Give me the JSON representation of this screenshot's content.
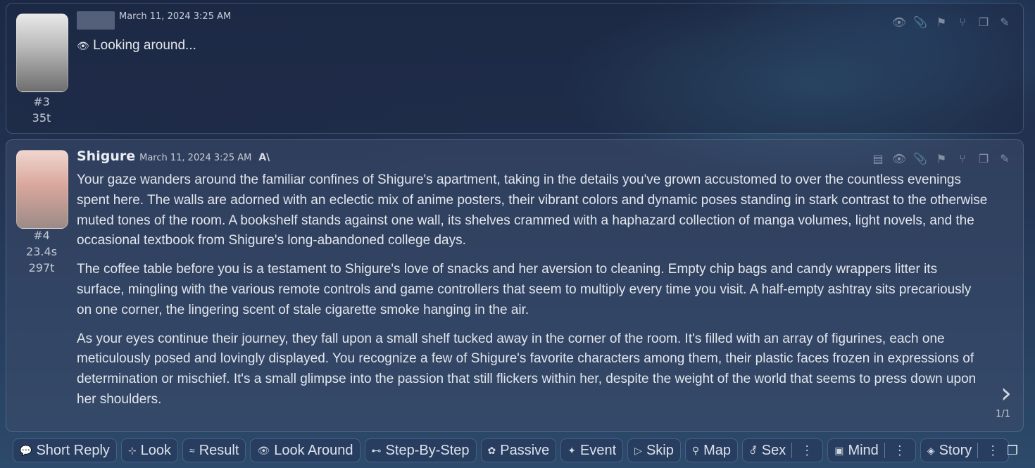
{
  "messages": [
    {
      "id": "#3",
      "tokens": "35t",
      "name": "",
      "timestamp": "March 11, 2024 3:25 AM",
      "text_icon": "eye-icon",
      "text": "Looking around..."
    },
    {
      "id": "#4",
      "gen_time": "23.4s",
      "tokens": "297t",
      "name": "Shigure",
      "timestamp": "March 11, 2024 3:25 AM",
      "model_badge": "A\\",
      "paragraphs": [
        "Your gaze wanders around the familiar confines of Shigure's apartment, taking in the details you've grown accustomed to over the countless evenings spent here. The walls are adorned with an eclectic mix of anime posters, their vibrant colors and dynamic poses standing in stark contrast to the otherwise muted tones of the room. A bookshelf stands against one wall, its shelves crammed with a haphazard collection of manga volumes, light novels, and the occasional textbook from Shigure's long-abandoned college days.",
        "The coffee table before you is a testament to Shigure's love of snacks and her aversion to cleaning. Empty chip bags and candy wrappers litter its surface, mingling with the various remote controls and game controllers that seem to multiply every time you visit. A half-empty ashtray sits precariously on one corner, the lingering scent of stale cigarette smoke hanging in the air.",
        "As your eyes continue their journey, they fall upon a small shelf tucked away in the corner of the room. It's filled with an array of figurines, each one meticulously posed and lovingly displayed. You recognize a few of Shigure's favorite characters among them, their plastic faces frozen in expressions of determination or mischief. It's a small glimpse into the passion that still flickers within her, despite the weight of the world that seems to press down upon her shoulders."
      ],
      "swipe_counter": "1/1"
    }
  ],
  "quick_replies": [
    {
      "icon": "chat-bubbles-icon",
      "label": "Short Reply"
    },
    {
      "icon": "crosshair-icon",
      "label": "Look"
    },
    {
      "icon": "approx-icon",
      "label": "Result"
    },
    {
      "icon": "eye-icon",
      "label": "Look Around"
    },
    {
      "icon": "key-icon",
      "label": "Step-By-Step"
    },
    {
      "icon": "flower-icon",
      "label": "Passive"
    },
    {
      "icon": "sparkle-icon",
      "label": "Event"
    },
    {
      "icon": "play-icon",
      "label": "Skip"
    },
    {
      "icon": "pin-icon",
      "label": "Map"
    },
    {
      "icon": "gender-icon",
      "label": "Sex"
    },
    {
      "icon": "square-icon",
      "label": "Mind"
    },
    {
      "icon": "diamond-icon",
      "label": "Story"
    }
  ]
}
